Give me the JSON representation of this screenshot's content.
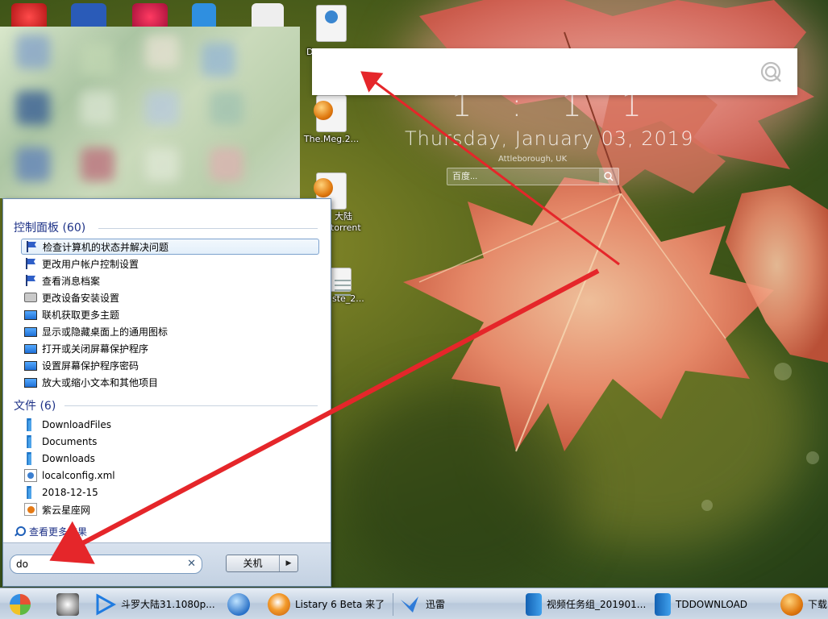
{
  "desktop": {
    "icons": [
      {
        "label": "D",
        "kind": "web"
      },
      {
        "label": "The.Meg.2...",
        "kind": "torrent"
      },
      {
        "label": "大陆",
        "label2": "torrent",
        "kind": "torrent"
      },
      {
        "label": "ste_2...",
        "kind": "doc"
      }
    ]
  },
  "listary": {
    "query": "",
    "search_icon": "listary-search-icon"
  },
  "clock": {
    "time": "1 : 1 1",
    "date": "Thursday, January 03, 2019",
    "location": "Attleborough, UK",
    "search_placeholder": "百度..."
  },
  "start_menu": {
    "groups": [
      {
        "title": "控制面板 (60)",
        "items": [
          {
            "label": "检查计算机的状态并解决问题",
            "icon": "flag-icon",
            "selected": true
          },
          {
            "label": "更改用户帐户控制设置",
            "icon": "flag-icon"
          },
          {
            "label": "查看消息档案",
            "icon": "flag-icon"
          },
          {
            "label": "更改设备安装设置",
            "icon": "printer-icon"
          },
          {
            "label": "联机获取更多主题",
            "icon": "monitor-icon"
          },
          {
            "label": "显示或隐藏桌面上的通用图标",
            "icon": "monitor-icon"
          },
          {
            "label": "打开或关闭屏幕保护程序",
            "icon": "monitor-icon"
          },
          {
            "label": "设置屏幕保护程序密码",
            "icon": "monitor-icon"
          },
          {
            "label": "放大或缩小文本和其他项目",
            "icon": "monitor-icon"
          }
        ]
      },
      {
        "title": "文件 (6)",
        "items": [
          {
            "label": "DownloadFiles",
            "icon": "folder-icon"
          },
          {
            "label": "Documents",
            "icon": "folder-icon"
          },
          {
            "label": "Downloads",
            "icon": "folder-icon"
          },
          {
            "label": "localconfig.xml",
            "icon": "xml-file-icon"
          },
          {
            "label": "2018-12-15",
            "icon": "folder-icon"
          },
          {
            "label": "紫云星座网",
            "icon": "web-shortcut-icon"
          }
        ]
      }
    ],
    "see_more": "查看更多结果",
    "search_value": "do",
    "clear": "✕",
    "shutdown_label": "关机",
    "shutdown_arrow": "▶"
  },
  "taskbar": {
    "items": [
      {
        "label": "",
        "icon": "fox-icon"
      },
      {
        "label": "斗罗大陆31.1080p....",
        "icon": "play-icon"
      },
      {
        "label": "",
        "icon": "globe-icon"
      },
      {
        "label": "Listary 6 Beta 来了 ...",
        "icon": "listary-icon"
      },
      {
        "label": "迅雷",
        "icon": "thunder-icon"
      },
      {
        "label": "视频任务组_201901...",
        "icon": "folder-icon"
      },
      {
        "label": "TDDOWNLOAD",
        "icon": "folder-icon"
      },
      {
        "label": "下载",
        "icon": "torrent-icon"
      }
    ]
  },
  "colors": {
    "arrow": "#e5262a",
    "start_menu_heading": "#1e3287",
    "selection_border": "#7da2ce"
  }
}
